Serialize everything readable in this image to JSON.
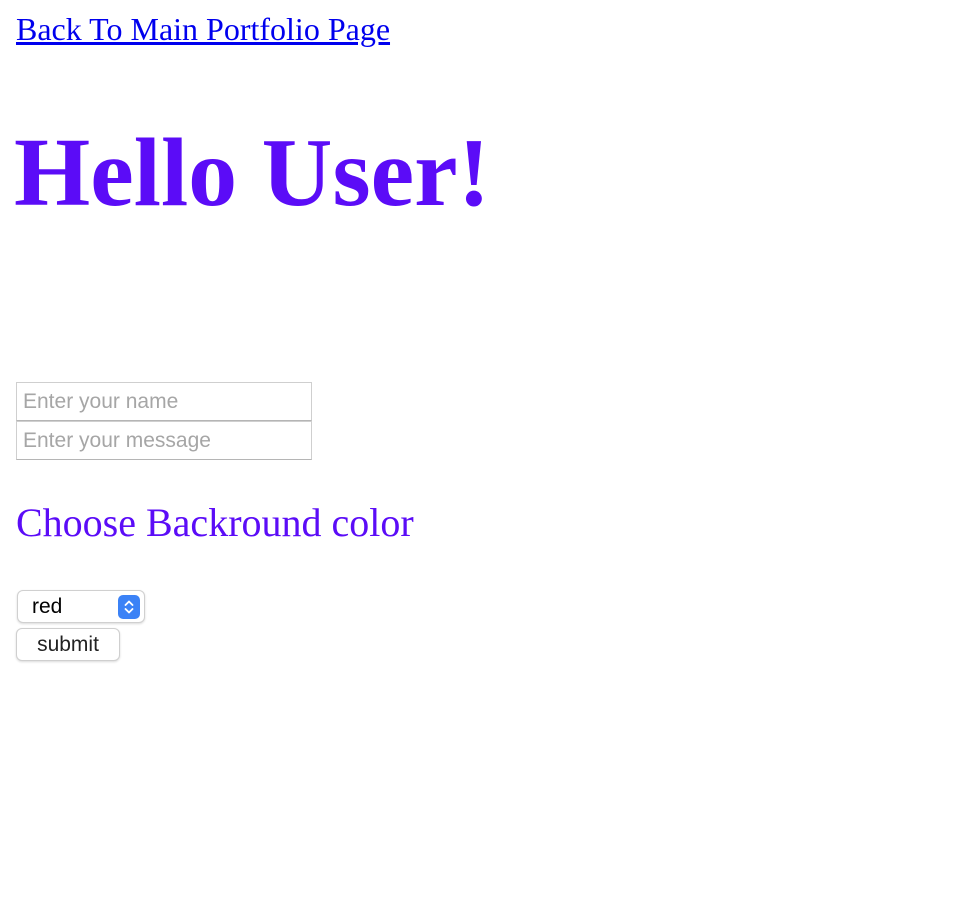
{
  "nav": {
    "back_link": "Back To Main Portfolio Page"
  },
  "header": {
    "title": "Hello User!"
  },
  "form": {
    "name_placeholder": "Enter your name",
    "name_value": "",
    "message_placeholder": "Enter your message",
    "message_value": "",
    "background_heading": "Choose Backround color",
    "color_select": {
      "selected": "red",
      "icon": "chevron-up-down-icon"
    },
    "submit_label": "submit"
  },
  "colors": {
    "link": "#0000ee",
    "accent": "#5b0cf7",
    "select_stepper": "#3b82f6"
  }
}
